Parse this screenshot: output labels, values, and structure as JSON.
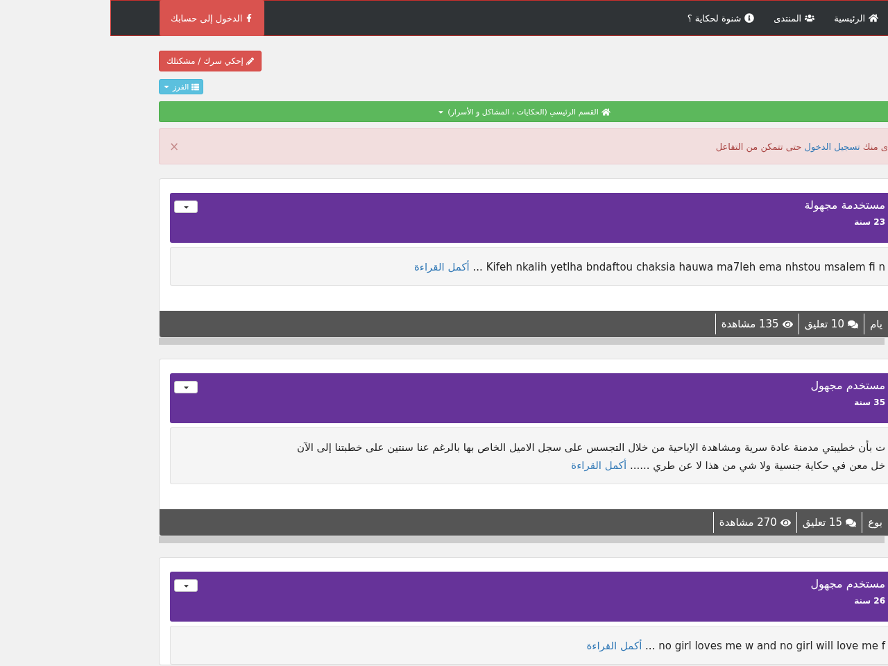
{
  "navbar": {
    "items": [
      {
        "label": "الرئيسية"
      },
      {
        "label": "المنتدى"
      },
      {
        "label": "شنوة لحكاية ؟"
      }
    ],
    "login_button": "الدخول إلى حسابك"
  },
  "share_button": "إحكي سرك / مشكتلك",
  "sort_button": "الفرز",
  "section_bar": "القسم الرئيسي (الحكايات ، المشاكل و الأسرار)",
  "alert": {
    "before": "ى منك",
    "link": "تسجيل الدخول",
    "after": "حتى تتمكن من التفاعل",
    "close": "×"
  },
  "posts": [
    {
      "author": "مستخدمة مجهولة",
      "age": "23 سنة",
      "lines": [
        "Kifeh nkalih yetlha bndaftou chaksia hauwa ma7leh ema nhstou msalem fi n"
      ],
      "more_mark": "...",
      "more": "أكمل القراءة",
      "stats": [
        {
          "kind": "time",
          "text": "يام"
        },
        {
          "kind": "comments",
          "text": "10 تعليق"
        },
        {
          "kind": "views",
          "text": "135 مشاهدة"
        }
      ]
    },
    {
      "author": "مستخدم مجهول",
      "age": "35 سنة",
      "lines": [
        "ت بأن خطيبتي مدمنة عادة سرية ومشاهدة الإباحية من خلال التجسس على سجل الاميل الخاص بها بالرغم عنا سنتين على خطبتنا إلى الآن",
        "خل معن في حكاية جنسية ولا شي من هذا لا عن طري"
      ],
      "more_mark": "......",
      "more": "أكمل القراءة",
      "stats": [
        {
          "kind": "time",
          "text": "بوع"
        },
        {
          "kind": "comments",
          "text": "15 تعليق"
        },
        {
          "kind": "views",
          "text": "270 مشاهدة"
        }
      ]
    },
    {
      "author": "مستخدم مجهول",
      "age": "26 سنة",
      "lines": [
        "no girl loves me w and no girl will love me f"
      ],
      "more_mark": "...",
      "more": "أكمل القراءة"
    }
  ]
}
